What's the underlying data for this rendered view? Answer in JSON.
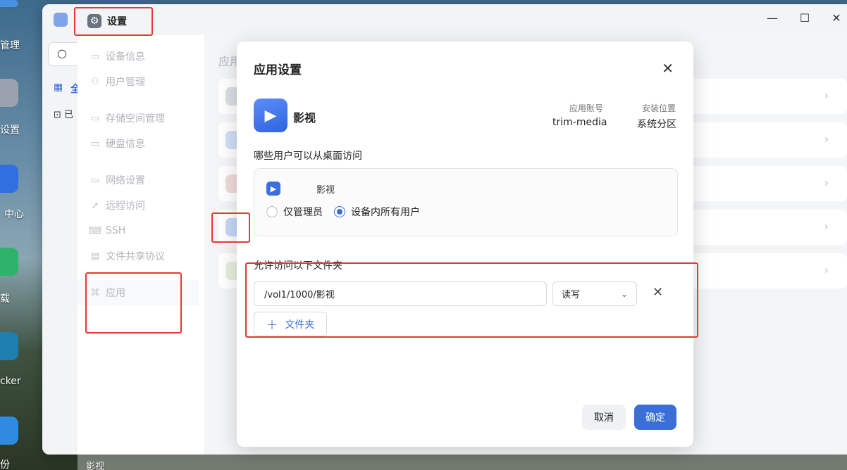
{
  "desktop": {
    "icons": [
      {
        "label": "管理",
        "color": "#4a90e2"
      },
      {
        "label": "设置",
        "color": "#9aa3ad"
      },
      {
        "label": "中心",
        "color": "#2f6fe0"
      },
      {
        "label": "载",
        "color": "#2fb36a"
      },
      {
        "label": "cker",
        "color": "#1e7fb0"
      },
      {
        "label": "份",
        "color": "#2f8be0"
      }
    ],
    "bottom_label": "影视"
  },
  "window": {
    "settings_tab_label": "设置",
    "gear_icon": "gear-icon",
    "controls": {
      "minimize": "—",
      "maximize": "☐",
      "close": "✕"
    }
  },
  "left_col": {
    "grid_text": "全",
    "app_text": "已"
  },
  "nav": {
    "items": [
      {
        "label": "设备信息",
        "icon": "▭"
      },
      {
        "label": "用户管理",
        "icon": "⚇"
      },
      {
        "label": "存储空间管理",
        "icon": "▭"
      },
      {
        "label": "硬盘信息",
        "icon": "▭"
      },
      {
        "label": "网络设置",
        "icon": "▭"
      },
      {
        "label": "远程访问",
        "icon": "➚"
      },
      {
        "label": "SSH",
        "icon": "⌨"
      },
      {
        "label": "文件共享协议",
        "icon": "▤"
      },
      {
        "label": "应用",
        "icon": "⌘"
      }
    ]
  },
  "content": {
    "title": "应用"
  },
  "dialog": {
    "title": "应用设置",
    "close_label": "✕",
    "app_name": "影视",
    "account_label": "应用账号",
    "account_value": "trim-media",
    "location_label": "安装位置",
    "location_value": "系统分区",
    "access_label": "哪些用户可以从桌面访问",
    "access_app_name": "影视",
    "radio_admin": "仅管理员",
    "radio_all": "设备内所有用户",
    "folder_label": "允许访问以下文件夹",
    "folder_path": "/vol1/1000/影视",
    "permission": "读写",
    "add_folder": "文件夹",
    "cancel": "取消",
    "ok": "确定"
  }
}
